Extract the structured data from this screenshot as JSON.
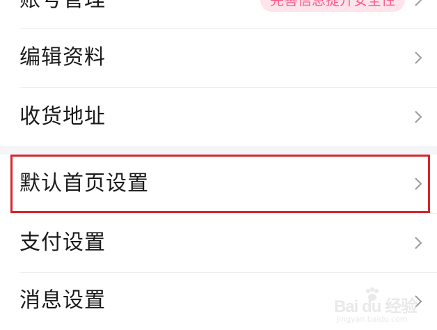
{
  "menu": {
    "items": [
      {
        "label": "账号管理",
        "badge": "完善信息提升安全性"
      },
      {
        "label": "编辑资料"
      },
      {
        "label": "收货地址"
      },
      {
        "label": "默认首页设置"
      },
      {
        "label": "支付设置"
      },
      {
        "label": "消息设置"
      }
    ]
  },
  "watermark": {
    "text": "Bai du 经验",
    "sub": "jingyan.baidu.com"
  },
  "colors": {
    "highlight": "#d6262d",
    "badge_bg": "#ffe4ec",
    "badge_text": "#ff5a8a",
    "section_gap": "#f5f5f7"
  }
}
